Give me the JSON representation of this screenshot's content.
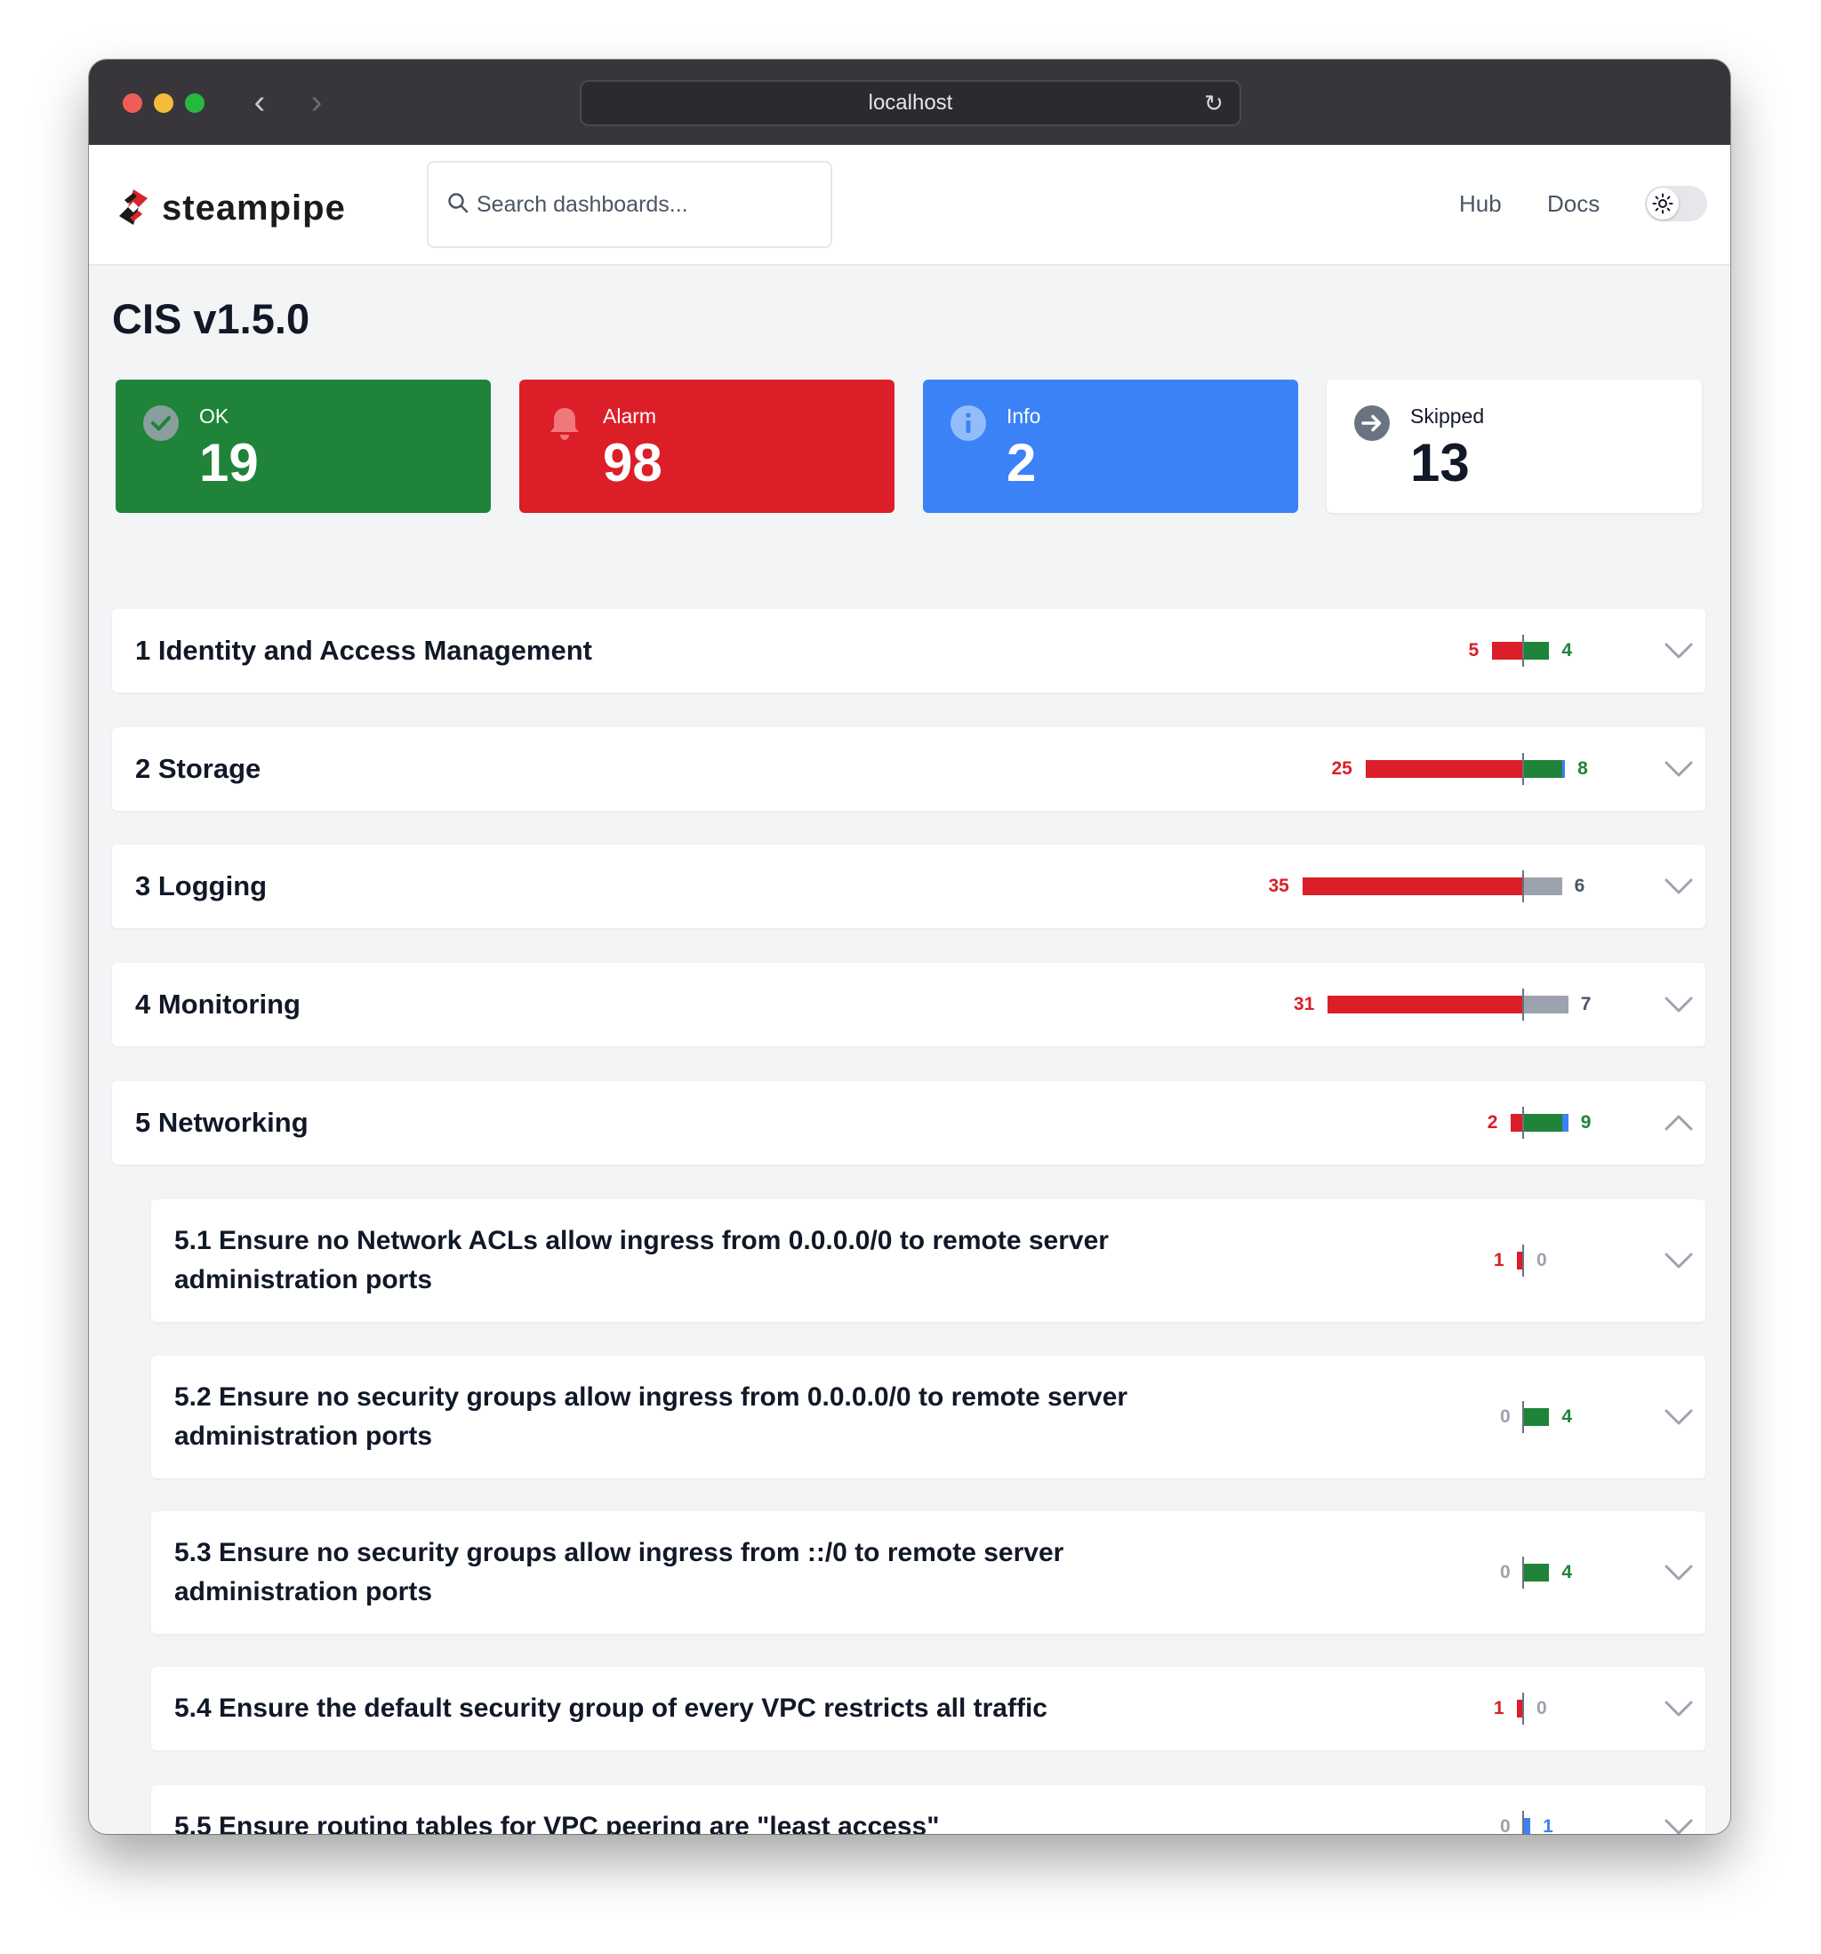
{
  "browser": {
    "url": "localhost"
  },
  "header": {
    "brand": "steampipe",
    "search_placeholder": "Search dashboards...",
    "links": [
      "Hub",
      "Docs"
    ]
  },
  "page": {
    "title": "CIS v1.5.0"
  },
  "summary": {
    "ok": {
      "label": "OK",
      "value": "19"
    },
    "alarm": {
      "label": "Alarm",
      "value": "98"
    },
    "info": {
      "label": "Info",
      "value": "2"
    },
    "skipped": {
      "label": "Skipped",
      "value": "13"
    }
  },
  "colors": {
    "ok": "#1f8439",
    "alarm": "#dc1e28",
    "info": "#3b82f6",
    "skipped": "#9ca3af"
  },
  "benchmarks": [
    {
      "title": "1 Identity and Access Management",
      "left": "5",
      "right": "4",
      "expanded": false,
      "segments": {
        "alarm": 5,
        "ok": 4,
        "info": 0,
        "skip": 0
      }
    },
    {
      "title": "2 Storage",
      "left": "25",
      "right": "8",
      "expanded": false,
      "segments": {
        "alarm": 25,
        "ok": 6,
        "info": 0.5,
        "skip": 0
      }
    },
    {
      "title": "3 Logging",
      "left": "35",
      "right": "6",
      "expanded": false,
      "segments": {
        "alarm": 35,
        "ok": 0,
        "info": 0,
        "skip": 6
      }
    },
    {
      "title": "4 Monitoring",
      "left": "31",
      "right": "7",
      "expanded": false,
      "segments": {
        "alarm": 31,
        "ok": 0,
        "info": 0,
        "skip": 7
      }
    },
    {
      "title": "5 Networking",
      "left": "2",
      "right": "9",
      "expanded": true,
      "segments": {
        "alarm": 2,
        "ok": 6,
        "info": 1,
        "skip": 0
      }
    }
  ],
  "controls": [
    {
      "title_l1": "5.1 Ensure no Network ACLs allow ingress from 0.0.0.0/0 to remote server",
      "title_l2": "administration ports",
      "left": "1",
      "right": "0"
    },
    {
      "title_l1": "5.2 Ensure no security groups allow ingress from 0.0.0.0/0 to remote server",
      "title_l2": "administration ports",
      "left": "0",
      "right": "4"
    },
    {
      "title_l1": "5.3 Ensure no security groups allow ingress from ::/0 to remote server",
      "title_l2": "administration ports",
      "left": "0",
      "right": "4"
    },
    {
      "title_l1": "5.4 Ensure the default security group of every VPC restricts all traffic",
      "title_l2": "",
      "left": "1",
      "right": "0"
    },
    {
      "title_l1": "5.5 Ensure routing tables for VPC peering are \"least access\"",
      "title_l2": "",
      "left": "0",
      "right": "1"
    }
  ]
}
